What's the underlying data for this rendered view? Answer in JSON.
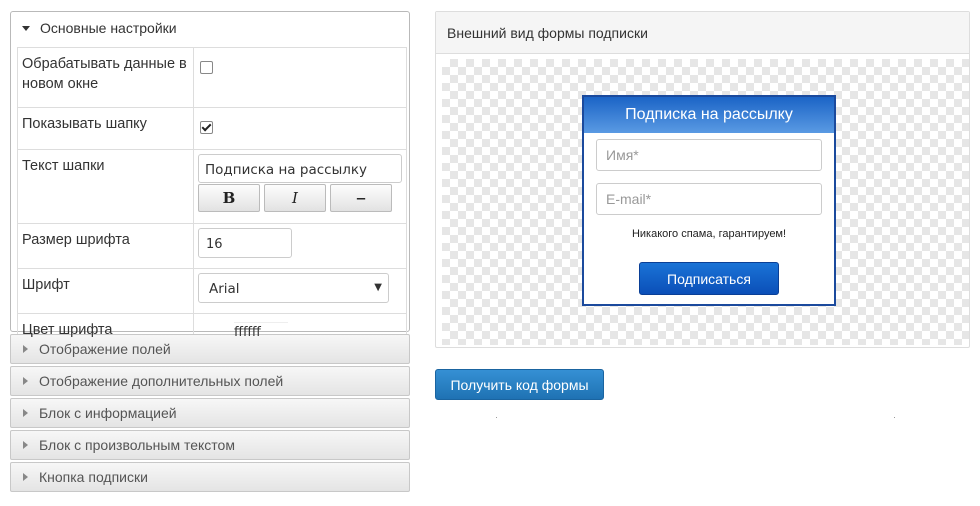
{
  "left": {
    "main_section": {
      "title": "Основные настройки",
      "rows": {
        "new_window": {
          "label": "Обрабатывать данные в новом окне",
          "checked": false
        },
        "show_header": {
          "label": "Показывать шапку",
          "checked": true
        },
        "header_text": {
          "label": "Текст шапки",
          "value": "Подписка на рассылку",
          "bold_label": "B",
          "italic_label": "I",
          "strike_label": "‒"
        },
        "font_size": {
          "label": "Размер шрифта",
          "value": "16"
        },
        "font": {
          "label": "Шрифт",
          "value": "Arial"
        },
        "font_color": {
          "label": "Цвет шрифта",
          "value": "ffffff"
        }
      }
    },
    "collapsed_sections": [
      "Отображение полей",
      "Отображение дополнительных полей",
      "Блок с информацией",
      "Блок с произвольным текстом",
      "Кнопка подписки"
    ]
  },
  "preview": {
    "title": "Внешний вид формы подписки",
    "form": {
      "header": "Подписка на рассылку",
      "name_placeholder": "Имя*",
      "email_placeholder": "E-mail*",
      "note": "Никакого спама, гарантируем!",
      "submit_label": "Подписаться"
    }
  },
  "get_code_label": "Получить код формы"
}
